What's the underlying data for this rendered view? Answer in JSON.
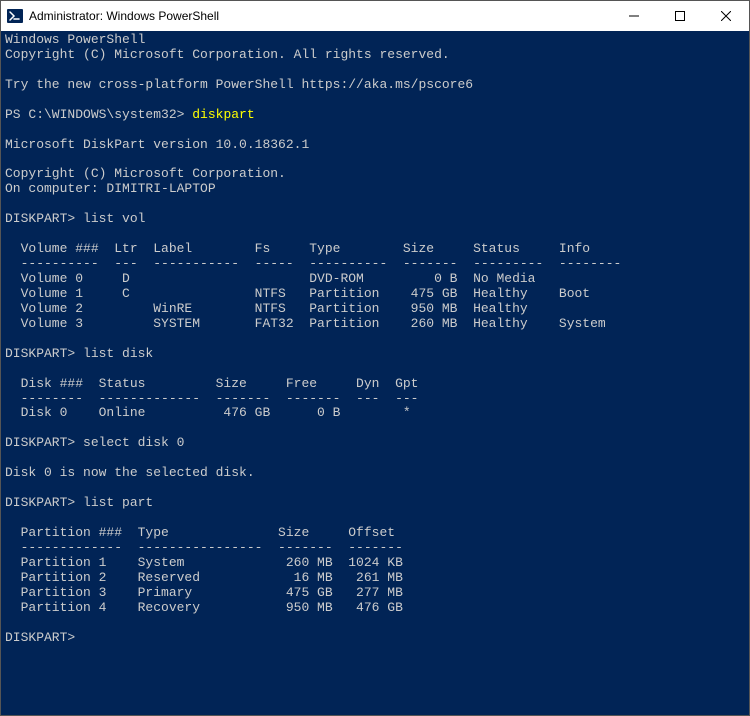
{
  "window": {
    "title": "Administrator: Windows PowerShell"
  },
  "header": {
    "line1": "Windows PowerShell",
    "line2": "Copyright (C) Microsoft Corporation. All rights reserved.",
    "try_line": "Try the new cross-platform PowerShell https://aka.ms/pscore6"
  },
  "ps": {
    "prompt": "PS C:\\WINDOWS\\system32> ",
    "cmd": "diskpart"
  },
  "dp_header": {
    "version": "Microsoft DiskPart version 10.0.18362.1",
    "copyright": "Copyright (C) Microsoft Corporation.",
    "computer": "On computer: DIMITRI-LAPTOP"
  },
  "sessions": {
    "p1": "DISKPART> ",
    "cmd1": "list vol",
    "vol_header": "  Volume ###  Ltr  Label        Fs     Type        Size     Status     Info",
    "vol_sep": "  ----------  ---  -----------  -----  ----------  -------  ---------  --------",
    "vol_rows": [
      "  Volume 0     D                       DVD-ROM         0 B  No Media",
      "  Volume 1     C                NTFS   Partition    475 GB  Healthy    Boot",
      "  Volume 2         WinRE        NTFS   Partition    950 MB  Healthy",
      "  Volume 3         SYSTEM       FAT32  Partition    260 MB  Healthy    System"
    ],
    "cmd2": "list disk",
    "disk_header": "  Disk ###  Status         Size     Free     Dyn  Gpt",
    "disk_sep": "  --------  -------------  -------  -------  ---  ---",
    "disk_rows": [
      "  Disk 0    Online          476 GB      0 B        *"
    ],
    "cmd3": "select disk 0",
    "sel_msg": "Disk 0 is now the selected disk.",
    "cmd4": "list part",
    "part_header": "  Partition ###  Type              Size     Offset",
    "part_sep": "  -------------  ----------------  -------  -------",
    "part_rows": [
      "  Partition 1    System             260 MB  1024 KB",
      "  Partition 2    Reserved            16 MB   261 MB",
      "  Partition 3    Primary            475 GB   277 MB",
      "  Partition 4    Recovery           950 MB   476 GB"
    ],
    "final_prompt": "DISKPART> "
  }
}
